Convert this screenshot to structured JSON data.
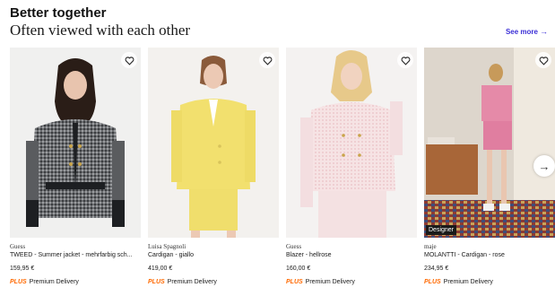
{
  "header": {
    "eyebrow": "Better together",
    "headline": "Often viewed with each other",
    "see_more": "See more",
    "see_more_arrow": "→"
  },
  "products": [
    {
      "brand": "Guess",
      "name": "TWEED - Summer jacket - mehrfarbig sch...",
      "price": "159,95 €",
      "plus_mark": "PLUS",
      "delivery": "Premium Delivery"
    },
    {
      "brand": "Luisa Spagnoli",
      "name": "Cardigan - giallo",
      "price": "419,00 €",
      "plus_mark": "PLUS",
      "delivery": "Premium Delivery"
    },
    {
      "brand": "Guess",
      "name": "Blazer - hellrose",
      "price": "160,00 €",
      "plus_mark": "PLUS",
      "delivery": "Premium Delivery"
    },
    {
      "brand": "maje",
      "name": "MOLANTTI - Cardigan - rose",
      "price": "234,95 €",
      "plus_mark": "PLUS",
      "delivery": "Premium Delivery",
      "badge": "Designer"
    }
  ],
  "next_arrow": "→",
  "icons": {
    "favorite": "heart-outline-icon",
    "carousel_next": "arrow-right-icon"
  },
  "colors": {
    "link": "#3b2fd6",
    "plus": "#ff6900"
  }
}
